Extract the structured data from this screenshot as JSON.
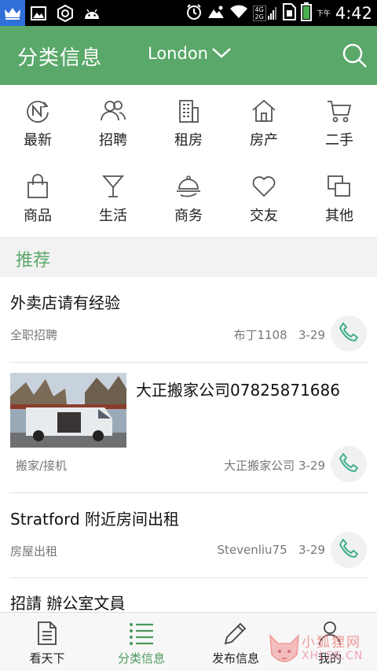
{
  "status_bar": {
    "time": "4:42",
    "ampm": "下午",
    "network_top": "4G",
    "network_bottom": "2G"
  },
  "header": {
    "title": "分类信息",
    "city": "London",
    "accent_color": "#5aa86a"
  },
  "categories": [
    {
      "label": "最新",
      "icon": "new-icon"
    },
    {
      "label": "招聘",
      "icon": "people-icon"
    },
    {
      "label": "租房",
      "icon": "building-icon"
    },
    {
      "label": "房产",
      "icon": "house-icon"
    },
    {
      "label": "二手",
      "icon": "cart-icon"
    },
    {
      "label": "商品",
      "icon": "bag-icon"
    },
    {
      "label": "生活",
      "icon": "cocktail-icon"
    },
    {
      "label": "商务",
      "icon": "cloche-icon"
    },
    {
      "label": "交友",
      "icon": "heart-icon"
    },
    {
      "label": "其他",
      "icon": "squares-icon"
    }
  ],
  "recommend": {
    "title": "推荐"
  },
  "listings": [
    {
      "title": "外卖店请有经验",
      "category": "全职招聘",
      "author": "布丁1108",
      "date": "3-29",
      "has_image": false
    },
    {
      "title": "大正搬家公司07825871686",
      "category": "搬家/接机",
      "author": "大正搬家公司",
      "date": "3-29",
      "has_image": true
    },
    {
      "title": "Stratford 附近房间出租",
      "category": "房屋出租",
      "author": "Stevenliu75",
      "date": "3-29",
      "has_image": false
    },
    {
      "title": "招請 辦公室文員",
      "category": "",
      "author": "",
      "date": "",
      "has_image": false
    }
  ],
  "bottom_nav": [
    {
      "label": "看天下",
      "icon": "document-icon",
      "active": false
    },
    {
      "label": "分类信息",
      "icon": "list-icon",
      "active": true
    },
    {
      "label": "发布信息",
      "icon": "pencil-icon",
      "active": false
    },
    {
      "label": "我的",
      "icon": "person-icon",
      "active": false
    }
  ],
  "watermark": {
    "line1": "小狐狸网",
    "line2": "XHLSS.CN"
  }
}
